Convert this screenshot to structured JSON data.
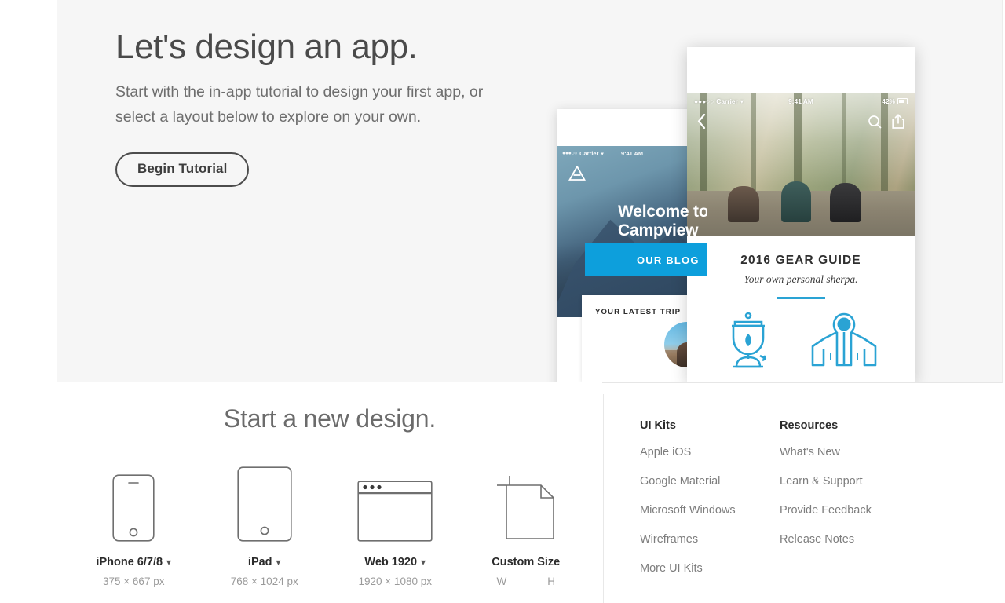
{
  "hero": {
    "title": "Let's design an app.",
    "subtitle": "Start with the in-app tutorial to design your first app, or select a layout below to explore on your own.",
    "begin_button": "Begin Tutorial"
  },
  "phone_back": {
    "status": {
      "dots": "●●●○○",
      "carrier": "Carrier",
      "wifi": "▾",
      "time": "9:41 AM"
    },
    "welcome_line1": "Welcome to",
    "welcome_line2": "Campview",
    "blog_button": "OUR BLOG",
    "card_label": "YOUR LATEST TRIP",
    "logo_icon": "triangle-logo-icon",
    "accent_color": "#0d9fdc"
  },
  "phone_front": {
    "status": {
      "dots": "●●●○○",
      "carrier": "Carrier",
      "wifi": "▾",
      "time": "9:41 AM",
      "battery": "42%"
    },
    "back_icon": "chevron-left-icon",
    "search_icon": "search-icon",
    "share_icon": "share-icon",
    "kicker": "2016 GEAR GUIDE",
    "tagline": "Your own personal sherpa.",
    "icon_stove": "camp-stove-icon",
    "icon_jacket": "jacket-icon",
    "accent_color": "#2aa3d4"
  },
  "new_design": {
    "title": "Start a new design.",
    "presets": [
      {
        "label": "iPhone 6/7/8",
        "dims": "375 × 667 px",
        "icon": "iphone-icon",
        "has_chevron": true
      },
      {
        "label": "iPad",
        "dims": "768 × 1024 px",
        "icon": "ipad-icon",
        "has_chevron": true
      },
      {
        "label": "Web 1920",
        "dims": "1920 × 1080 px",
        "icon": "browser-window-icon",
        "has_chevron": true
      },
      {
        "label": "Custom Size",
        "icon": "custom-page-icon",
        "has_chevron": false,
        "width_field": "W",
        "height_field": "H"
      }
    ]
  },
  "footer": {
    "columns": [
      {
        "heading": "UI Kits",
        "items": [
          "Apple iOS",
          "Google Material",
          "Microsoft Windows",
          "Wireframes",
          "More UI Kits"
        ]
      },
      {
        "heading": "Resources",
        "items": [
          "What's New",
          "Learn & Support",
          "Provide Feedback",
          "Release Notes"
        ]
      }
    ]
  }
}
